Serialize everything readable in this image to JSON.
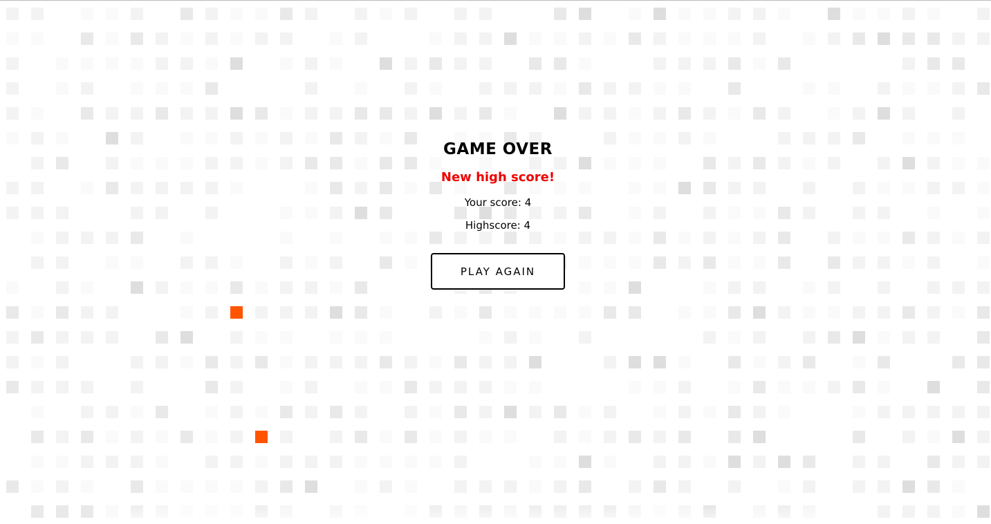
{
  "game_over": {
    "title": "GAME OVER",
    "new_highscore_label": "New high score!",
    "score_label": "Your score:",
    "score_value": "4",
    "highscore_label": "Highscore:",
    "highscore_value": "4",
    "play_again_label": "PLAY AGAIN"
  },
  "colors": {
    "snake_food": "#ff5500",
    "highscore_text": "#ee0000",
    "grid_shades": [
      "#fafafa",
      "#f3f3f3",
      "#e9e9e9",
      "#dedede"
    ]
  },
  "board": {
    "columns": 40,
    "rows": 21,
    "highlighted_cells": [
      {
        "col": 9,
        "row": 12
      },
      {
        "col": 10,
        "row": 17
      }
    ]
  }
}
